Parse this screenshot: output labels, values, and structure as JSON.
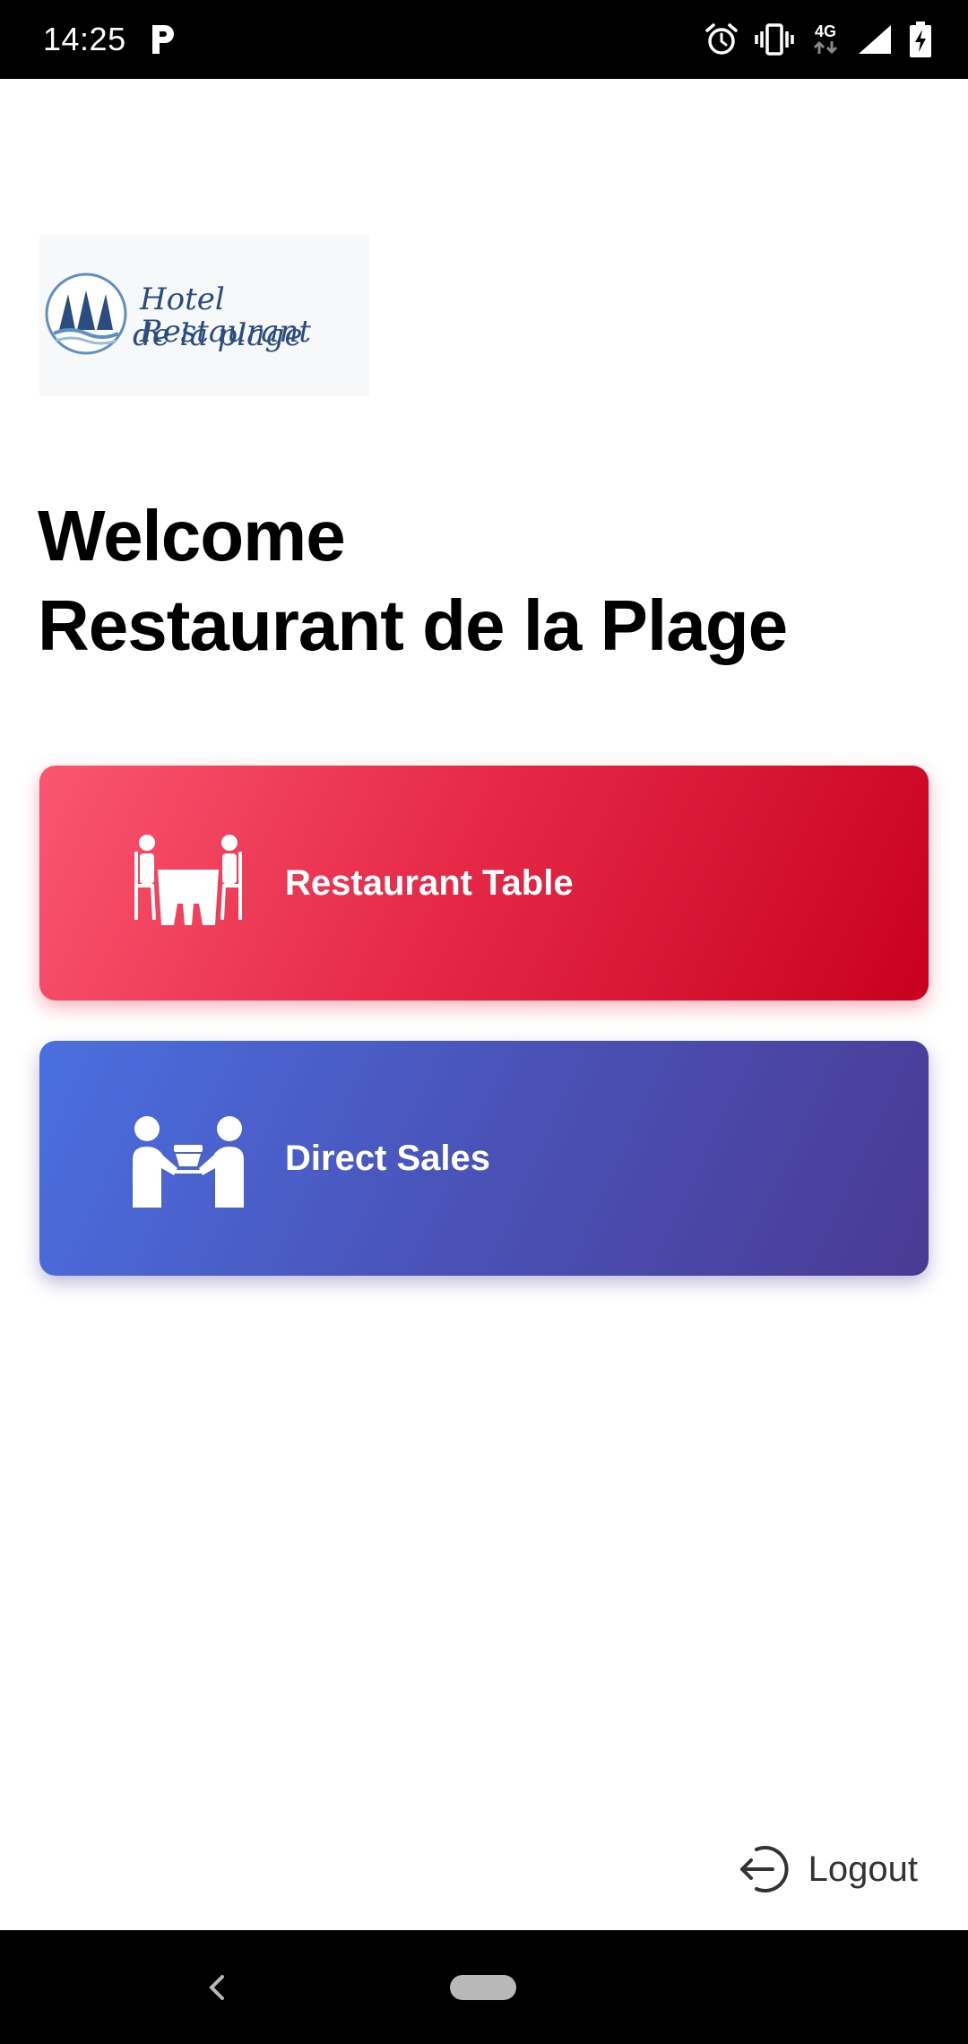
{
  "status_bar": {
    "time": "14:25",
    "network": "4G",
    "icons": [
      "parking-icon",
      "alarm-icon",
      "vibrate-icon",
      "network-icon",
      "signal-icon",
      "battery-charging-icon"
    ]
  },
  "logo": {
    "line1": "Hotel Restaurant",
    "line2": "de la plage",
    "icon": "sailboat-emblem-icon"
  },
  "welcome": {
    "line1": "Welcome",
    "line2": "Restaurant de la Plage"
  },
  "cards": {
    "restaurant_table": {
      "label": "Restaurant Table",
      "icon": "dining-table-icon",
      "gradient": [
        "#fa5670",
        "#c90020"
      ]
    },
    "direct_sales": {
      "label": "Direct Sales",
      "icon": "handover-icon",
      "gradient": [
        "#4a6fe0",
        "#4a3a94"
      ]
    }
  },
  "logout": {
    "label": "Logout",
    "icon": "logout-icon"
  },
  "nav_bar": {
    "icons": [
      "back-icon",
      "home-pill-icon"
    ]
  }
}
